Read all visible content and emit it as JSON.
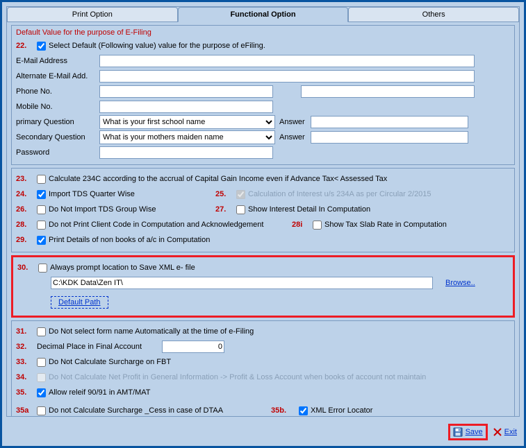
{
  "tabs": {
    "print": "Print Option",
    "functional": "Functional Option",
    "others": "Others"
  },
  "section_default": {
    "title": "Default Value for the purpose of E-Filing",
    "n22": "22.",
    "l22": "Select Default (Following value) value for the purpose of eFiling.",
    "email_lbl": "E-Mail Address",
    "alt_email_lbl": "Alternate E-Mail Add.",
    "phone_lbl": "Phone No.",
    "mobile_lbl": "Mobile No.",
    "primq_lbl": "primary Question",
    "primq_val": "What is your first school name",
    "answer_lbl": "Answer",
    "secq_lbl": "Secondary Question",
    "secq_val": "What is your mothers maiden name",
    "password_lbl": "Password"
  },
  "opts": {
    "n23": "23.",
    "l23": "Calculate 234C according to the accrual of Capital Gain Income even if Advance Tax< Assessed Tax",
    "n24": "24.",
    "l24": "Import TDS Quarter Wise",
    "n25": "25.",
    "l25": "Calculation of Interest u/s 234A as per Circular 2/2015",
    "n26": "26.",
    "l26": "Do Not Import TDS Group Wise",
    "n27": "27.",
    "l27": "Show Interest Detail In Computation",
    "n28": "28.",
    "l28": "Do not Print Client Code in Computation and Acknowledgement",
    "n28i": "28i",
    "l28i": "Show Tax Slab Rate in Computation",
    "n29": "29.",
    "l29": "Print Details of non books of a/c in Computation",
    "n30": "30.",
    "l30": "Always prompt location to Save XML e- file",
    "path30": "C:\\KDK Data\\Zen IT\\",
    "browse": "Browse..",
    "default_path": "Default Path",
    "n31": "31.",
    "l31": "Do Not select form name Automatically at the time of e-Filing",
    "n32": "32.",
    "l32": "Decimal Place in Final Account",
    "v32": "0",
    "n33": "33.",
    "l33": "Do Not Calculate Surcharge on FBT",
    "n34": "34.",
    "l34": "Do Not  Calculate Net Profit in General Information -> Profit & Loss Account when books of account not maintain",
    "n35": "35.",
    "l35": "Allow releif 90/91 in AMT/MAT",
    "n35a": "35a",
    "l35a": "Do not Calculate Surcharge _Cess in case of DTAA",
    "n35b": "35b.",
    "l35b": "XML Error Locator"
  },
  "footer": {
    "save": "Save",
    "exit": "Exit"
  }
}
